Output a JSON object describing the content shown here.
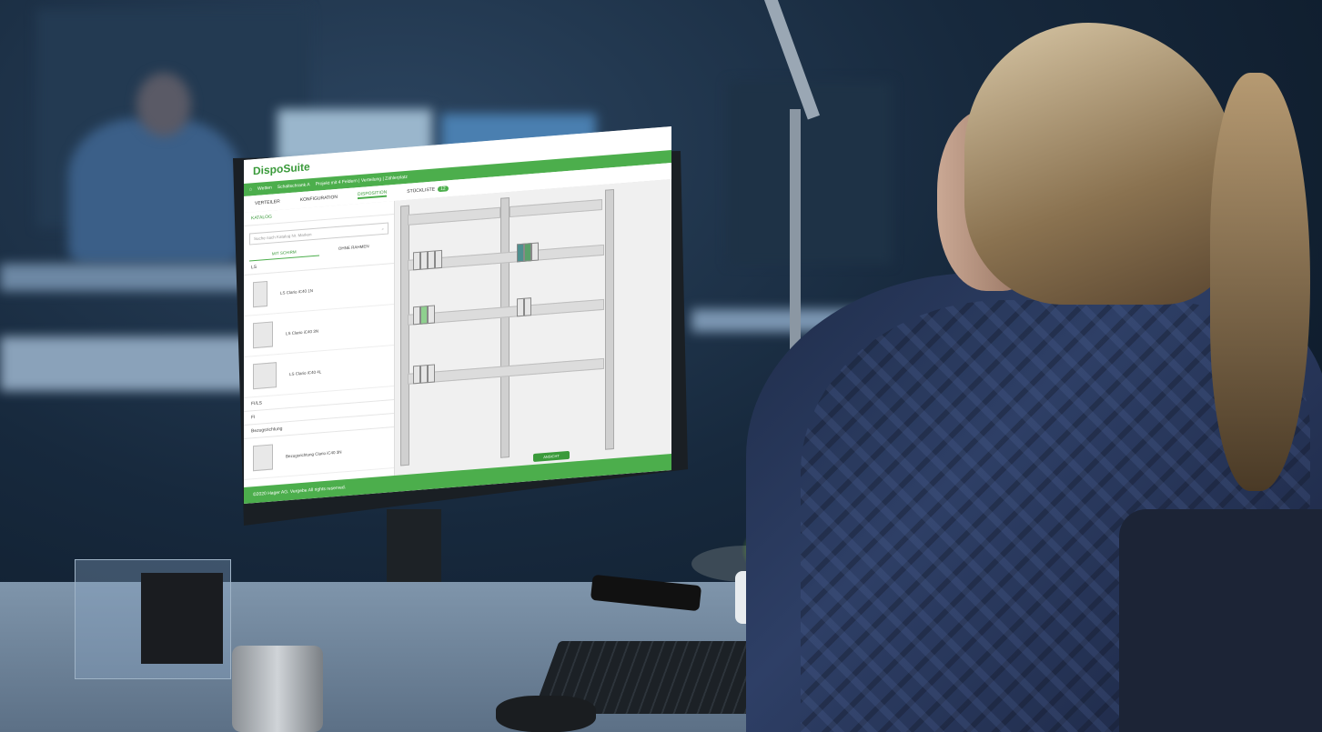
{
  "app": {
    "logo_text": "DispoSuite",
    "location": "Wetten",
    "subtitle": "Schaltschrank A",
    "info_line": "Projekt mit 4 Feldern | Verteilung | Zählerplatz"
  },
  "tabs": [
    {
      "label": "VERTEILER"
    },
    {
      "label": "KONFIGURATION"
    },
    {
      "label": "DISPOSITION"
    },
    {
      "label": "STÜCKLISTE",
      "badge": "12"
    }
  ],
  "catalog": {
    "header": "KATALOG",
    "search_placeholder": "Suche nach Katalog Nr. Marken",
    "toggle": [
      "MIT SCHIRM",
      "OHNE RAHMEN"
    ],
    "section_ls": "LS",
    "items": [
      {
        "label": "LS Clario iC40 1N"
      },
      {
        "label": "LS Clario iC40 3N"
      },
      {
        "label": "LS Clario iC40 4L"
      }
    ],
    "section_fi": "FI/LS",
    "section_fi2": "FI",
    "section_bz": "Bezugsrichtung",
    "bottom_item": "Bezugsrichtung Clario iC40 3N"
  },
  "canvas_button": "ANSICHT",
  "footer": "©2020 Hager AG. Vergebe All rights reserved.",
  "colors": {
    "accent": "#4cae4c",
    "screen_bg": "#f7f7f7",
    "room_bg": "#17293d"
  }
}
